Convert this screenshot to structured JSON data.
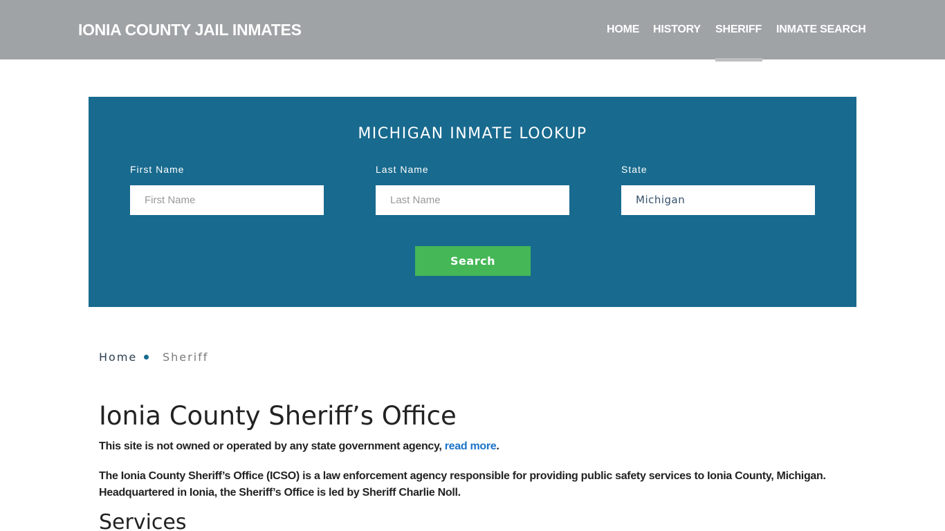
{
  "header": {
    "brand": "IONIA COUNTY JAIL INMATES",
    "nav": [
      {
        "label": "HOME"
      },
      {
        "label": "HISTORY"
      },
      {
        "label": "SHERIFF",
        "active": true
      },
      {
        "label": "INMATE SEARCH"
      }
    ]
  },
  "lookup": {
    "title": "MICHIGAN INMATE LOOKUP",
    "first_name": {
      "label": "First Name",
      "placeholder": "First Name",
      "value": ""
    },
    "last_name": {
      "label": "Last Name",
      "placeholder": "Last Name",
      "value": ""
    },
    "state": {
      "label": "State",
      "value": "Michigan"
    },
    "search_label": "Search"
  },
  "breadcrumb": {
    "home": "Home",
    "current": "Sheriff"
  },
  "content": {
    "title": "Ionia County Sheriff’s Office",
    "disclaimer_text": "This site is not owned or operated by any state government agency, ",
    "disclaimer_link": "read more",
    "disclaimer_end": ".",
    "intro": "The Ionia County Sheriff’s Office (ICSO) is a law enforcement agency responsible for providing public safety services to Ionia County, Michigan. Headquartered in Ionia, the Sheriff’s Office is led by Sheriff Charlie Noll.",
    "services_heading": "Services"
  },
  "colors": {
    "header_bg": "#9fa3a6",
    "lookup_bg": "#186a8e",
    "search_button": "#45b757",
    "link": "#1a73c8"
  }
}
